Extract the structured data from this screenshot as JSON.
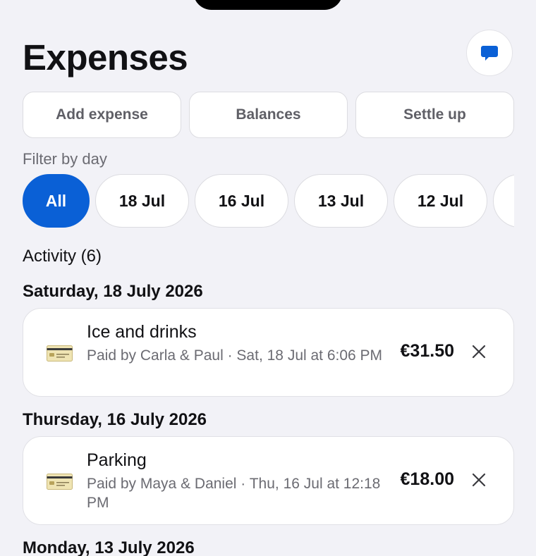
{
  "header": {
    "title": "Expenses",
    "chat_icon": "chat-bubble-icon",
    "accent_color": "#0a60d6"
  },
  "actions": {
    "add_expense": "Add expense",
    "balances": "Balances",
    "settle_up": "Settle up"
  },
  "filter": {
    "label": "Filter by day",
    "chips": [
      "All",
      "18 Jul",
      "16 Jul",
      "13 Jul",
      "12 Jul"
    ],
    "selected": "All"
  },
  "activity": {
    "heading": "Activity (6)",
    "groups": [
      {
        "date": "Saturday, 18 July 2026",
        "items": [
          {
            "icon": "credit-card-icon",
            "name": "Ice and drinks",
            "meta": "Paid by Carla & Paul · Sat, 18 Jul at 6:06 PM",
            "amount": "€31.50"
          }
        ]
      },
      {
        "date": "Thursday, 16 July 2026",
        "items": [
          {
            "icon": "credit-card-icon",
            "name": "Parking",
            "meta": "Paid by Maya & Daniel · Thu, 16 Jul at 12:18 PM",
            "amount": "€18.00"
          }
        ]
      },
      {
        "date": "Monday, 13 July 2026",
        "items": []
      }
    ]
  }
}
